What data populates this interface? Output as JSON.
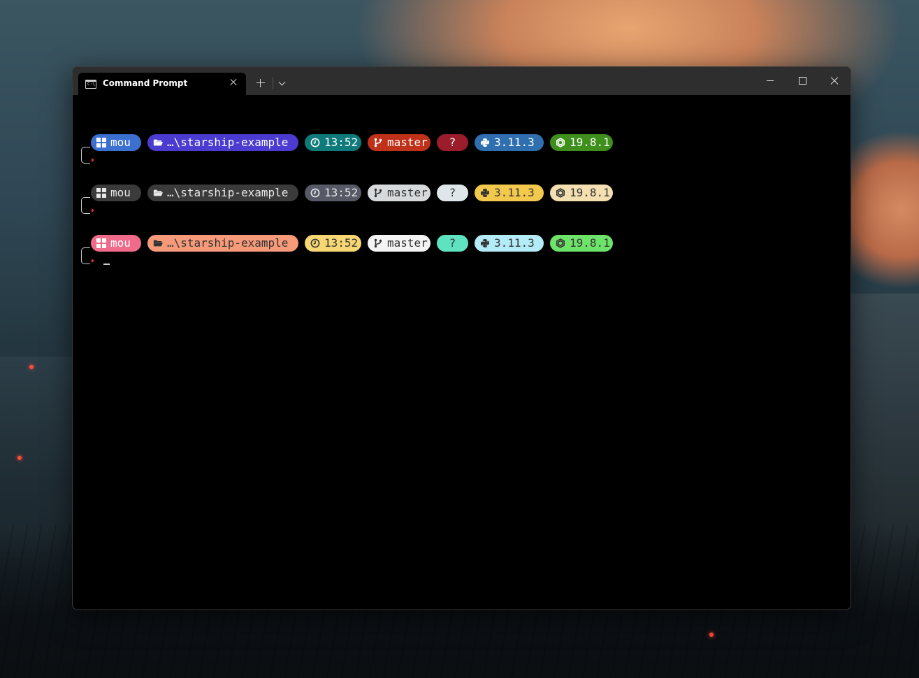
{
  "window": {
    "tab_title": "Command Prompt",
    "tab_icon": "cmd-icon",
    "tab_icon_text": "C:\\."
  },
  "prompts": [
    {
      "segments": [
        {
          "key": "user",
          "icon": "windows-icon",
          "text": "mou",
          "bg": "#3b6fd0",
          "fg": "#ffffff"
        },
        {
          "key": "directory",
          "icon": "folder-open-icon",
          "text": "…\\starship-example",
          "bg": "#4b3bd0",
          "fg": "#ffffff"
        },
        {
          "key": "time",
          "icon": "clock-icon",
          "text": "13:52",
          "bg": "#0f7a7a",
          "fg": "#ffffff"
        },
        {
          "key": "git_branch",
          "icon": "git-branch-icon",
          "text": "master",
          "bg": "#c0311a",
          "fg": "#ffffff"
        },
        {
          "key": "git_status",
          "icon": "",
          "text": "?",
          "bg": "#9b1c2b",
          "fg": "#ffffff"
        },
        {
          "key": "python",
          "icon": "python-icon",
          "text": "3.11.3",
          "bg": "#2f6fb0",
          "fg": "#ffffff"
        },
        {
          "key": "nodejs",
          "icon": "nodejs-icon",
          "text": "19.8.1",
          "bg": "#3f8f1d",
          "fg": "#ffffff"
        }
      ]
    },
    {
      "segments": [
        {
          "key": "user",
          "icon": "windows-icon",
          "text": "mou",
          "bg": "#3b3b3b",
          "fg": "#e8e8e8"
        },
        {
          "key": "directory",
          "icon": "folder-open-icon",
          "text": "…\\starship-example",
          "bg": "#3b3b3b",
          "fg": "#e8e8e8"
        },
        {
          "key": "time",
          "icon": "clock-icon",
          "text": "13:52",
          "bg": "#555a66",
          "fg": "#e8e8e8"
        },
        {
          "key": "git_branch",
          "icon": "git-branch-icon",
          "text": "master",
          "bg": "#d7dadc",
          "fg": "#333333"
        },
        {
          "key": "git_status",
          "icon": "",
          "text": "?",
          "bg": "#dfe6e9",
          "fg": "#333333"
        },
        {
          "key": "python",
          "icon": "python-icon",
          "text": "3.11.3",
          "bg": "#f2c94c",
          "fg": "#333333"
        },
        {
          "key": "nodejs",
          "icon": "nodejs-icon",
          "text": "19.8.1",
          "bg": "#f3dfb0",
          "fg": "#333333"
        }
      ]
    },
    {
      "segments": [
        {
          "key": "user",
          "icon": "windows-icon",
          "text": "mou",
          "bg": "#f06a8a",
          "fg": "#ffffff"
        },
        {
          "key": "directory",
          "icon": "folder-open-icon",
          "text": "…\\starship-example",
          "bg": "#f79a7a",
          "fg": "#333333"
        },
        {
          "key": "time",
          "icon": "clock-icon",
          "text": "13:52",
          "bg": "#f7d774",
          "fg": "#333333"
        },
        {
          "key": "git_branch",
          "icon": "git-branch-icon",
          "text": "master",
          "bg": "#f4f4f4",
          "fg": "#333333"
        },
        {
          "key": "git_status",
          "icon": "",
          "text": "?",
          "bg": "#5ee2c0",
          "fg": "#333333"
        },
        {
          "key": "python",
          "icon": "python-icon",
          "text": "3.11.3",
          "bg": "#b3ecf7",
          "fg": "#333333"
        },
        {
          "key": "nodejs",
          "icon": "nodejs-icon",
          "text": "19.8.1",
          "bg": "#6ee36a",
          "fg": "#333333"
        }
      ]
    }
  ]
}
